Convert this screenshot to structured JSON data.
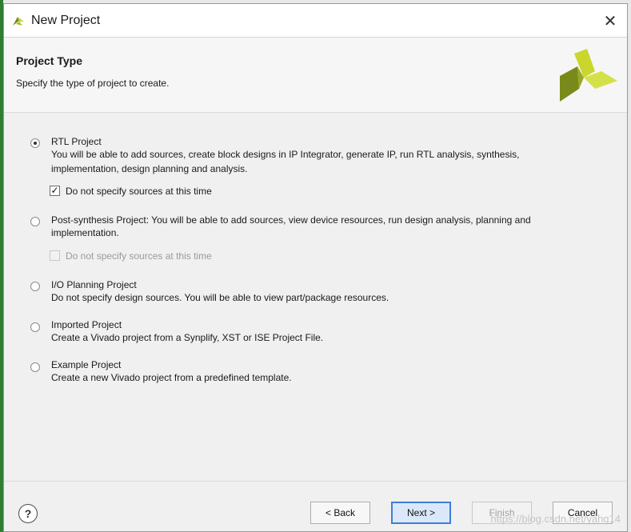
{
  "window": {
    "title": "New Project",
    "close_glyph": "✕"
  },
  "header": {
    "title": "Project Type",
    "subtitle": "Specify the type of project to create.",
    "logo_icon": "vivado-logo-icon"
  },
  "options": [
    {
      "title": "RTL Project",
      "description": [
        "You will be able to add sources, create block designs in IP Integrator, generate IP, run RTL analysis, synthesis,",
        "implementation, design planning and analysis."
      ],
      "selected": true
    },
    {
      "title": "Post-synthesis Project: You will be able to add sources, view device resources, run design analysis, planning and",
      "description": [
        "implementation."
      ],
      "selected": false
    },
    {
      "title": "I/O Planning Project",
      "description": [
        "Do not specify design sources. You will be able to view part/package resources."
      ],
      "selected": false
    },
    {
      "title": "Imported Project",
      "description": [
        "Create a Vivado project from a Synplify, XST or ISE Project File."
      ],
      "selected": false
    },
    {
      "title": "Example Project",
      "description": [
        "Create a new Vivado project from a predefined template."
      ],
      "selected": false
    }
  ],
  "checkboxes": [
    {
      "label": "Do not specify sources at this time",
      "checked": true,
      "enabled": true
    },
    {
      "label": "Do not specify sources at this time",
      "checked": false,
      "enabled": false
    }
  ],
  "footer": {
    "help_glyph": "?",
    "back_label": "< Back",
    "next_label": "Next >",
    "finish_label": "Finish",
    "cancel_label": "Cancel"
  },
  "watermark": "https://blog.csdn.net/yahg14",
  "colors": {
    "accent": "#3c7fd8",
    "logo_green": "#c8d62e",
    "logo_dark": "#7a8a1a"
  }
}
